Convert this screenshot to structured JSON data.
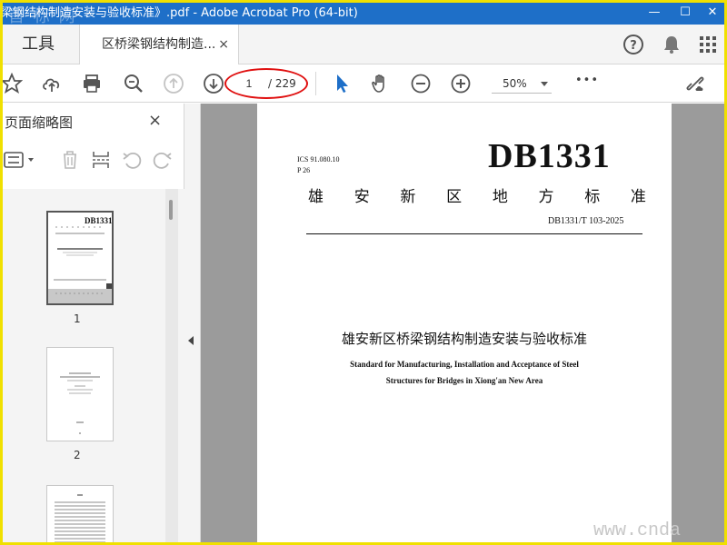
{
  "window": {
    "title": "梁钢结构制造安装与验收标准》.pdf - Adobe Acrobat Pro (64-bit)",
    "watermark": "首 标 网"
  },
  "tabs": {
    "tools_label": "工具",
    "doc_label": "区桥梁钢结构制造...",
    "close_glyph": "×"
  },
  "toolbar": {
    "current_page": "1",
    "total_pages": "/ 229",
    "zoom": "50%",
    "more": "•••"
  },
  "left_panel": {
    "title": "页面缩略图",
    "close_glyph": "×",
    "thumbnails": [
      {
        "number": "1"
      },
      {
        "number": "2"
      }
    ]
  },
  "document": {
    "ics": "ICS 91.080.10",
    "p": "P 26",
    "db": "DB1331",
    "std_name_chars": [
      "雄",
      "安",
      "新",
      "区",
      "地",
      "方",
      "标",
      "准"
    ],
    "code": "DB1331/T 103-2025",
    "cn_title": "雄安新区桥梁钢结构制造安装与验收标准",
    "en_title_line1": "Standard for Manufacturing, Installation and Acceptance of Steel",
    "en_title_line2": "Structures for Bridges in Xiong'an New Area"
  },
  "overlay": {
    "url_watermark": "www.cnda"
  },
  "colors": {
    "title_bar": "#1e6fc8",
    "highlight_ellipse": "#e01010",
    "frame": "#f0e000",
    "cursor_tool": "#1e6fc8"
  }
}
